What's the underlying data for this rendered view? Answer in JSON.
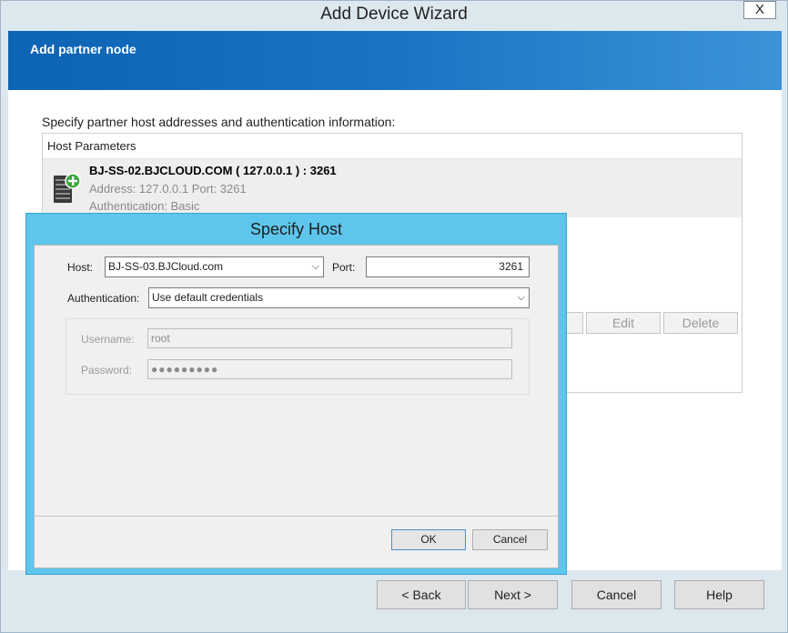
{
  "window": {
    "title": "Add Device Wizard",
    "close_label": "X"
  },
  "banner": {
    "title": "Add partner node"
  },
  "main": {
    "instruction": "Specify partner host addresses and authentication information:",
    "list_header": "Host Parameters",
    "host": {
      "name": "BJ-SS-02.BJCLOUD.COM ( 127.0.0.1 ) : 3261",
      "address": "Address: 127.0.0.1 Port: 3261",
      "authentication": "Authentication: Basic"
    },
    "buttons": {
      "edit": "Edit",
      "delete": "Delete"
    }
  },
  "footer": {
    "back": "< Back",
    "next": "Next >",
    "cancel": "Cancel",
    "help": "Help"
  },
  "dialog": {
    "title": "Specify Host",
    "host_label": "Host:",
    "host_value": "BJ-SS-03.BJCloud.com",
    "port_label": "Port:",
    "port_value": "3261",
    "auth_label": "Authentication:",
    "auth_value": "Use default credentials",
    "username_label": "Username:",
    "username_value": "root",
    "password_label": "Password:",
    "password_value": "●●●●●●●●●",
    "ok": "OK",
    "cancel": "Cancel"
  },
  "colors": {
    "banner": "#0d63b4",
    "dialog_frame": "#5ec6ec",
    "window_bg": "#dce7ee",
    "add_badge": "#3aa53a"
  },
  "icons": {
    "server": "server-add-icon",
    "dropdown": "chevron-down-icon"
  }
}
